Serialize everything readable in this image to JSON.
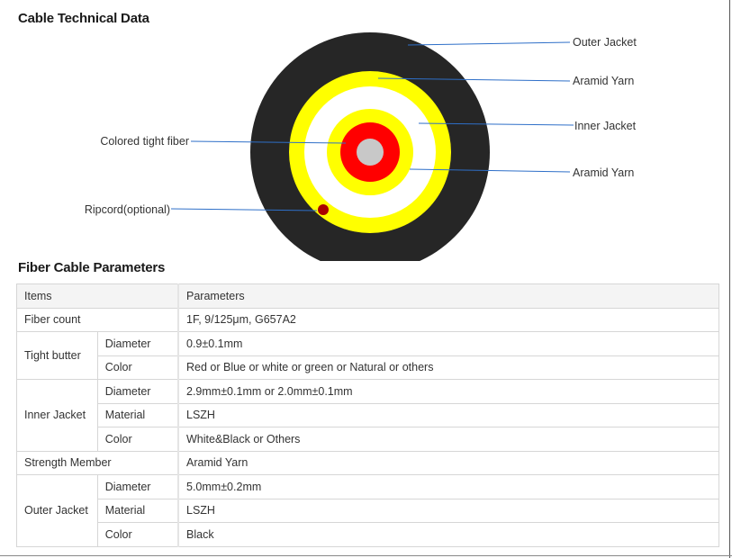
{
  "titles": {
    "technical": "Cable Technical Data",
    "parameters": "Fiber Cable Parameters"
  },
  "diagram": {
    "labels": {
      "outer_jacket": "Outer Jacket",
      "aramid_yarn_outer": "Aramid Yarn",
      "inner_jacket": "Inner Jacket",
      "aramid_yarn_inner": "Aramid Yarn",
      "colored_tight_fiber": "Colored tight fiber",
      "ripcord": "Ripcord(optional)"
    },
    "colors": {
      "outer_jacket": "#262626",
      "aramid_yarn": "#ffff00",
      "inner_jacket": "#ffffff",
      "tight_buffer": "#ff0000",
      "fiber_core": "#c8c8c8",
      "ripcord": "#aa0000",
      "leader_line": "#2e6fc8"
    }
  },
  "table": {
    "header": {
      "items": "Items",
      "parameters": "Parameters"
    },
    "fiber_count": {
      "label": "Fiber count",
      "value": "1F,  9/125μm,  G657A2"
    },
    "tight_butter": {
      "label": "Tight butter",
      "diameter_label": "Diameter",
      "diameter_value": "0.9±0.1mm",
      "color_label": "Color",
      "color_value": "Red or Blue or white or green or Natural or others"
    },
    "inner_jacket": {
      "label": "Inner Jacket",
      "diameter_label": "Diameter",
      "diameter_value": "2.9mm±0.1mm or 2.0mm±0.1mm",
      "material_label": "Material",
      "material_value": "LSZH",
      "color_label": "Color",
      "color_value": "White&Black or Others"
    },
    "strength_member": {
      "label": "Strength Member",
      "value": "Aramid Yarn"
    },
    "outer_jacket": {
      "label": "Outer Jacket",
      "diameter_label": "Diameter",
      "diameter_value": "5.0mm±0.2mm",
      "material_label": "Material",
      "material_value": "LSZH",
      "color_label": "Color",
      "color_value": "Black"
    }
  }
}
